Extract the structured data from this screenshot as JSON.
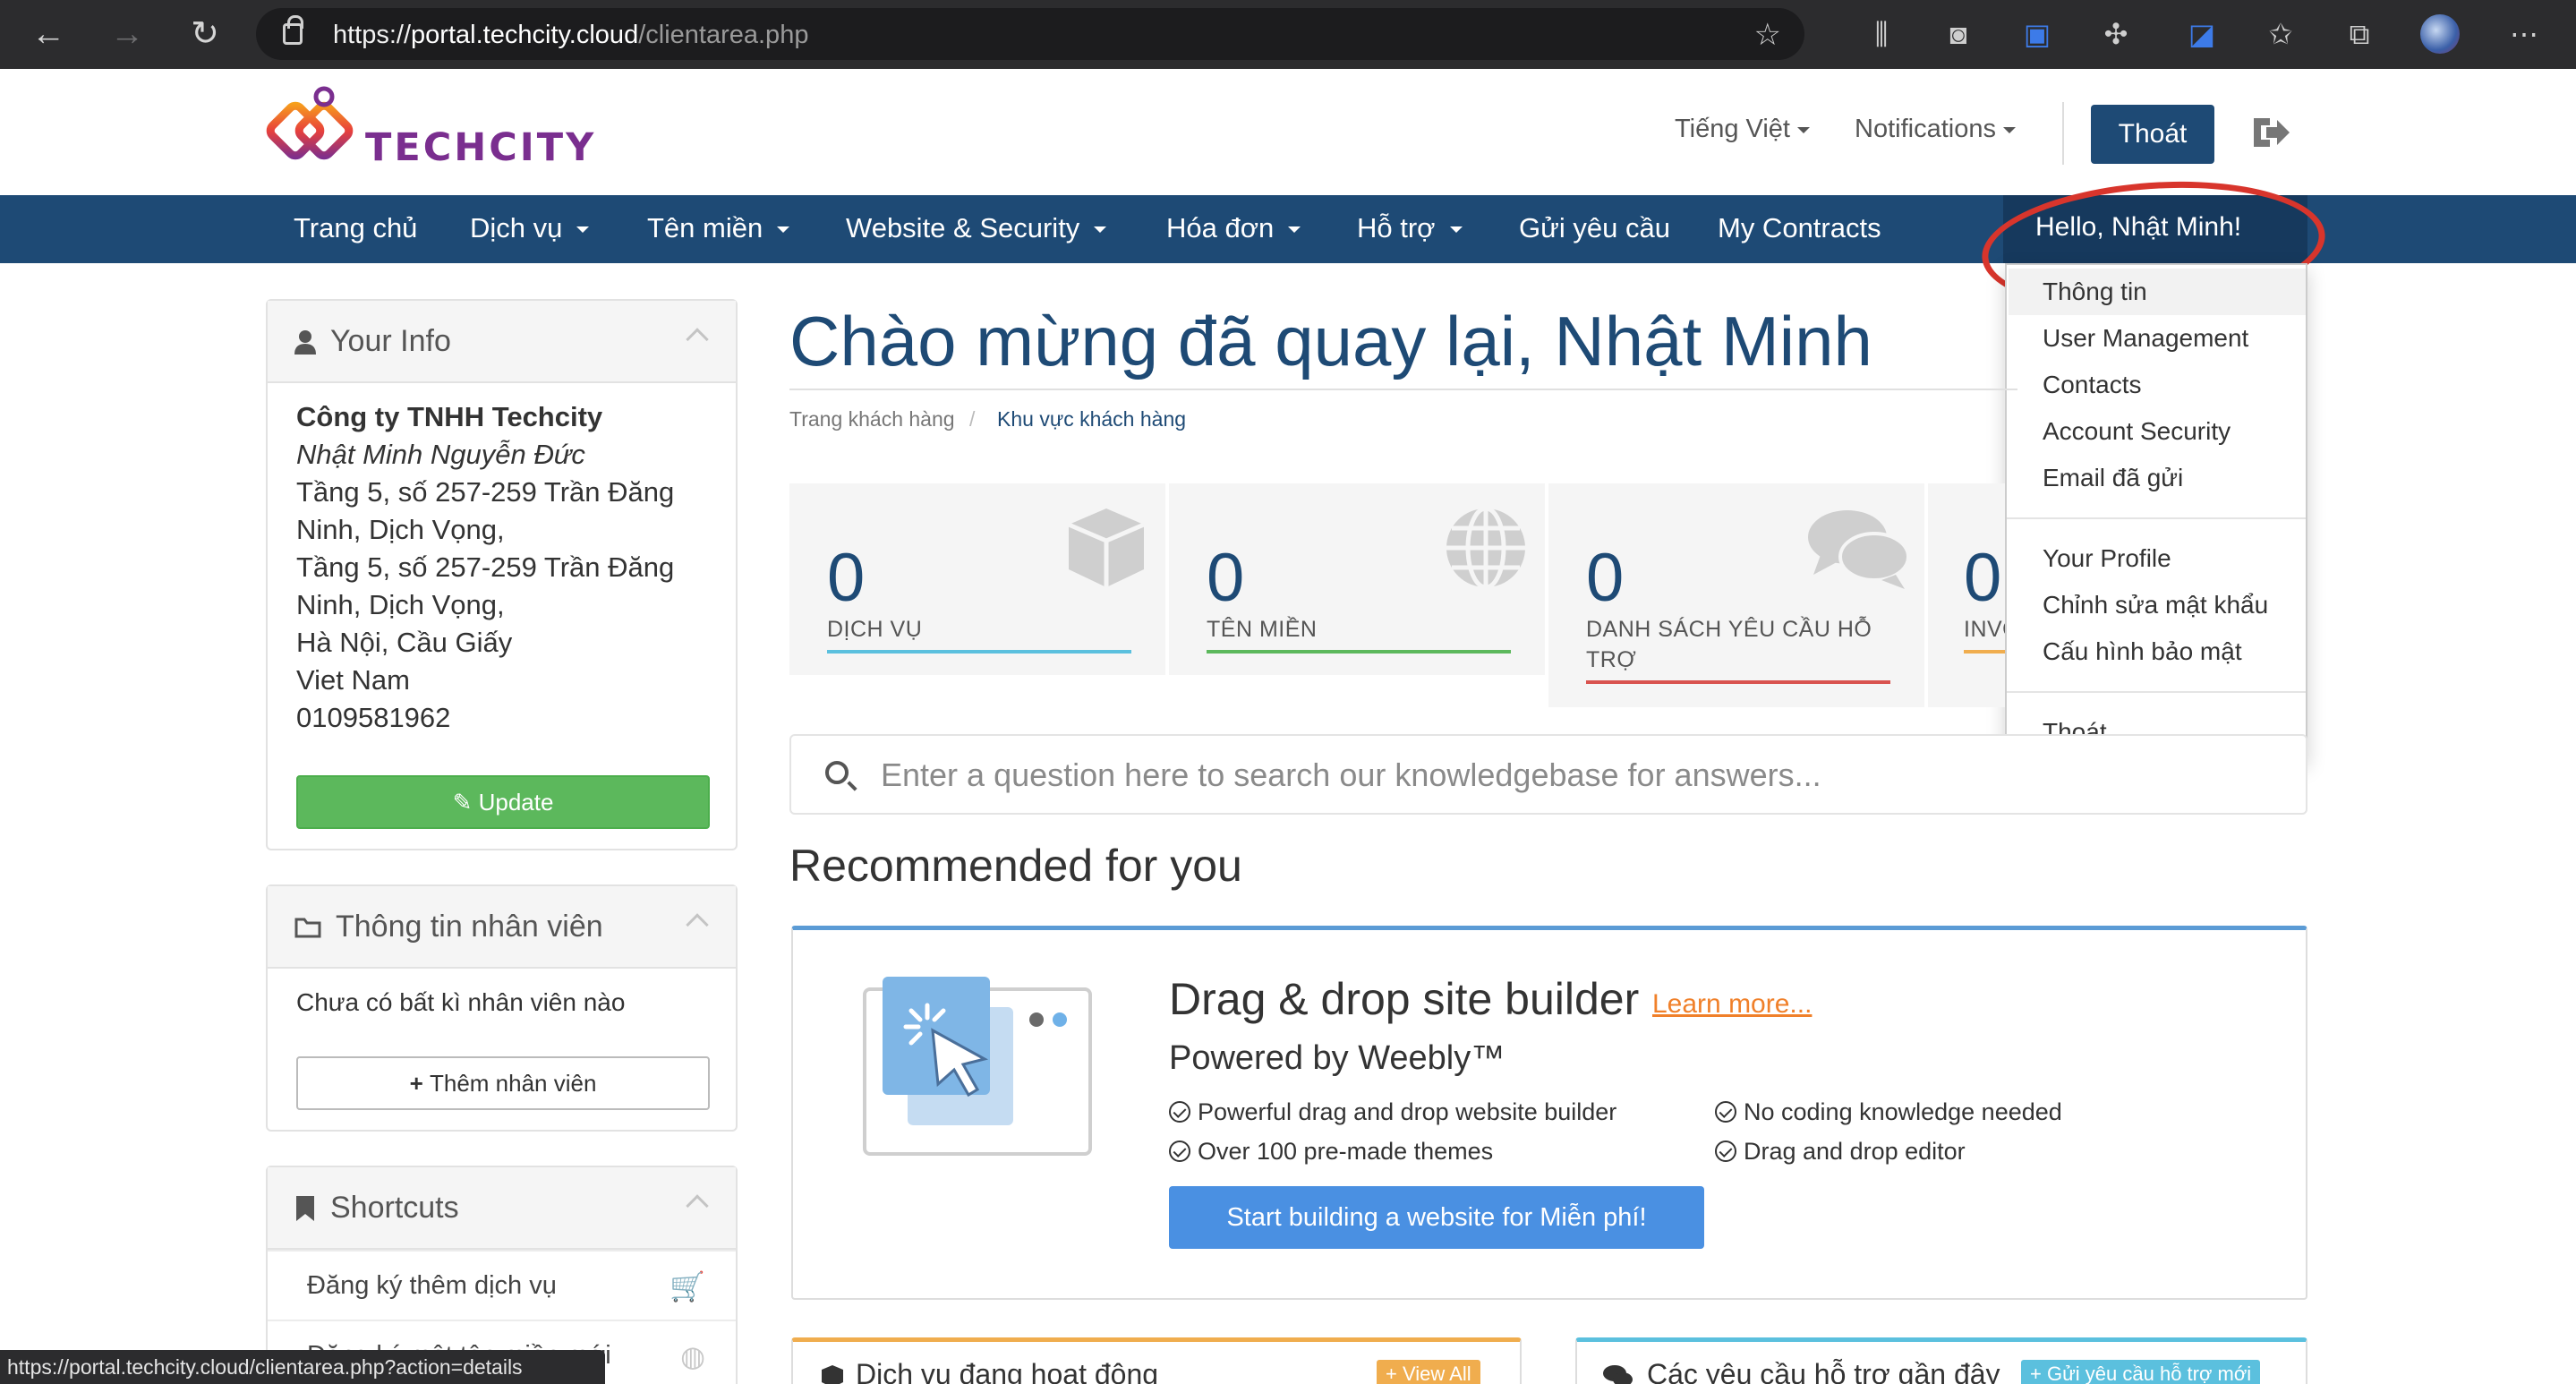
{
  "browser": {
    "url_scheme": "https://",
    "url_host": "portal.techcity.cloud",
    "url_path": "/clientarea.php",
    "status_url": "https://portal.techcity.cloud/clientarea.php?action=details"
  },
  "header": {
    "logo_text": "TECHCITY",
    "language": "Tiếng Việt",
    "notifications": "Notifications",
    "logout_button": "Thoát"
  },
  "nav": {
    "items": [
      "Trang chủ",
      "Dịch vụ",
      "Tên miền",
      "Website & Security",
      "Hóa đơn",
      "Hỗ trợ",
      "Gửi yêu cầu",
      "My Contracts"
    ],
    "account": "Hello, Nhật Minh!"
  },
  "account_menu": {
    "items": [
      "Thông tin",
      "User Management",
      "Contacts",
      "Account Security",
      "Email đã gửi",
      "Your Profile",
      "Chỉnh sửa mật khẩu",
      "Cấu hình bảo mật",
      "Thoát"
    ]
  },
  "your_info": {
    "title": "Your Info",
    "company": "Công ty TNHH Techcity",
    "name": "Nhật Minh Nguyễn Đức",
    "address_lines": [
      "Tầng 5, số 257-259 Trần Đăng",
      "Ninh, Dịch Vọng,",
      "Tầng 5, số 257-259 Trần Đăng",
      "Ninh, Dịch Vọng,",
      "Hà Nội, Cầu Giấy",
      "Viet Nam",
      "0109581962"
    ],
    "update_button": "Update"
  },
  "staff": {
    "title": "Thông tin nhân viên",
    "empty_text": "Chưa có bất kì nhân viên nào",
    "add_button": "Thêm nhân viên"
  },
  "shortcuts": {
    "title": "Shortcuts",
    "items": [
      "Đăng ký thêm dịch vụ",
      "Đăng ký một tên miền mới"
    ]
  },
  "main": {
    "welcome": "Chào mừng đã quay lại, Nhật Minh",
    "breadcrumb": [
      "Trang khách hàng",
      "Khu vực khách hàng"
    ],
    "breadcrumb_sep": "/",
    "tiles": [
      {
        "count": "0",
        "label": "DỊCH VỤ",
        "color": "#5bc0de"
      },
      {
        "count": "0",
        "label": "TÊN MIỀN",
        "color": "#5cb85c"
      },
      {
        "count": "0",
        "label": "DANH SÁCH YÊU CẦU HỖ TRỢ",
        "color": "#d9534f"
      },
      {
        "count": "0",
        "label": "INVOICES",
        "color": "#f0ad4e"
      }
    ],
    "kb_placeholder": "Enter a question here to search our knowledgebase for answers...",
    "recommended_title": "Recommended for you"
  },
  "promo": {
    "title": "Drag & drop site builder",
    "learn_more": "Learn more...",
    "subtitle": "Powered by Weebly™",
    "features": [
      "Powerful drag and drop website builder",
      "Over 100 pre-made themes",
      "No coding knowledge needed",
      "Drag and drop editor"
    ],
    "cta": "Start building a website for Miễn phí!"
  },
  "bottom": {
    "services_title": "Dịch vụ đang hoạt động",
    "services_button": "+ View All",
    "tickets_title": "Các yêu cầu hỗ trợ gần đây",
    "tickets_button": "+ Gửi yêu cầu hỗ trợ mới"
  }
}
